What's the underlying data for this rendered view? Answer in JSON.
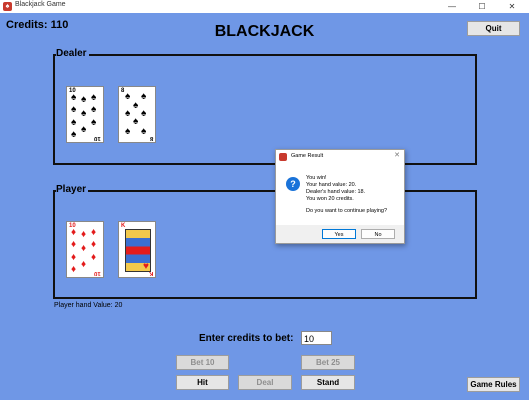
{
  "window": {
    "title": "Blackjack Game",
    "minimize_glyph": "—",
    "maximize_glyph": "☐",
    "close_glyph": "✕",
    "app_icon": "game-icon"
  },
  "header": {
    "credits": "Credits: 110",
    "title": "BLACKJACK",
    "quit_label": "Quit"
  },
  "dealer": {
    "label": "Dealer",
    "cards": [
      {
        "rank": "10",
        "suit": "♠",
        "color": "black"
      },
      {
        "rank": "8",
        "suit": "♠",
        "color": "black"
      }
    ]
  },
  "player": {
    "label": "Player",
    "cards": [
      {
        "rank": "10",
        "suit": "♦",
        "color": "red"
      },
      {
        "rank": "K",
        "suit": "♥",
        "color": "red"
      }
    ],
    "hand_value": "Player hand Value: 20"
  },
  "bet": {
    "label": "Enter credits to bet:",
    "value": "10"
  },
  "buttons": {
    "bet10": "Bet 10",
    "bet25": "Bet 25",
    "hit": "Hit",
    "deal": "Deal",
    "stand": "Stand",
    "game_rules": "Game Rules"
  },
  "dialog": {
    "title": "Game Result",
    "close_glyph": "✕",
    "icon": "question-icon",
    "lines": [
      "You win!",
      "Your hand value: 20.",
      "Dealer's hand value: 18.",
      "You won 20 credits.",
      "Do you want to continue playing?"
    ],
    "yes_label": "Yes",
    "no_label": "No"
  },
  "colors": {
    "background": "#6f97e6",
    "red_suit": "#e31c1c",
    "dialog_accent": "#0078d7"
  }
}
